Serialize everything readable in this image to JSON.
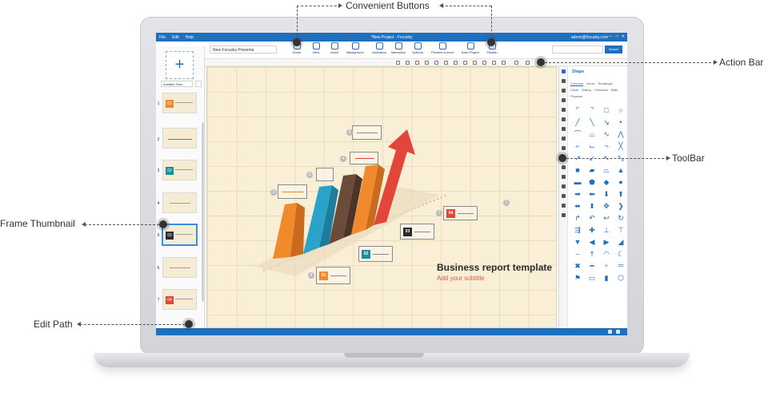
{
  "app": {
    "title": "*New Project - Focusky",
    "menu": [
      "File",
      "Edit",
      "Help"
    ],
    "user": "admin@focusky.com",
    "window_controls": [
      "—",
      "□",
      "✕"
    ]
  },
  "toolbar": {
    "project_name": "New Focusky Presenta",
    "buttons": [
      {
        "label": "Home",
        "icon": "home-icon"
      },
      {
        "label": "New",
        "icon": "new-file-icon"
      },
      {
        "label": "Insert",
        "icon": "insert-icon"
      },
      {
        "label": "Background",
        "icon": "background-icon"
      },
      {
        "label": "Animation",
        "icon": "animation-icon"
      },
      {
        "label": "Interaction",
        "icon": "interaction-icon"
      },
      {
        "label": "Options",
        "icon": "options-icon"
      },
      {
        "label": "Preview current",
        "icon": "preview-icon"
      },
      {
        "label": "Save Project",
        "icon": "save-icon"
      },
      {
        "label": "Publish",
        "icon": "publish-icon"
      }
    ],
    "search_label": "Search"
  },
  "left_panel": {
    "add_frame_symbol": "+",
    "frame_type": "Invisible Fran",
    "frames": [
      {
        "num": "1",
        "tile": "01",
        "color": "#f08a2a"
      },
      {
        "num": "2",
        "tile": "",
        "color": "#f6ecd4"
      },
      {
        "num": "3",
        "tile": "02",
        "color": "#1a8f9a"
      },
      {
        "num": "4",
        "tile": "",
        "color": "#f6ecd4"
      },
      {
        "num": "5",
        "tile": "03",
        "color": "#2b2b2b"
      },
      {
        "num": "6",
        "tile": "",
        "color": "#f6ecd4"
      },
      {
        "num": "7",
        "tile": "04",
        "color": "#e2463a"
      }
    ]
  },
  "slide": {
    "title": "Business report template",
    "subtitle": "Add your subtitle",
    "markers": [
      "1",
      "2",
      "3",
      "4",
      "5",
      "6",
      "7",
      "8"
    ],
    "tiles": [
      "01",
      "02",
      "03",
      "04"
    ],
    "colors": {
      "orange": "#f08a2a",
      "teal": "#1a8f9a",
      "dark": "#2b2b2b",
      "red": "#e2463a",
      "brown": "#6b4b3a",
      "blue": "#2aa3c9"
    }
  },
  "right_panel": {
    "title": "Shape",
    "tabs": [
      "Common",
      "Arrow",
      "Rectangle",
      "Circle",
      "Dialog",
      "Chemical",
      "Math",
      "Physical"
    ],
    "active_tab": "Common"
  },
  "callouts": {
    "convenient_buttons": "Convenient Buttons",
    "action_bar": "Action Bar",
    "toolbar": "ToolBar",
    "frame_thumbnail": "Frame Thumbnail",
    "edit_path": "Edit Path"
  }
}
